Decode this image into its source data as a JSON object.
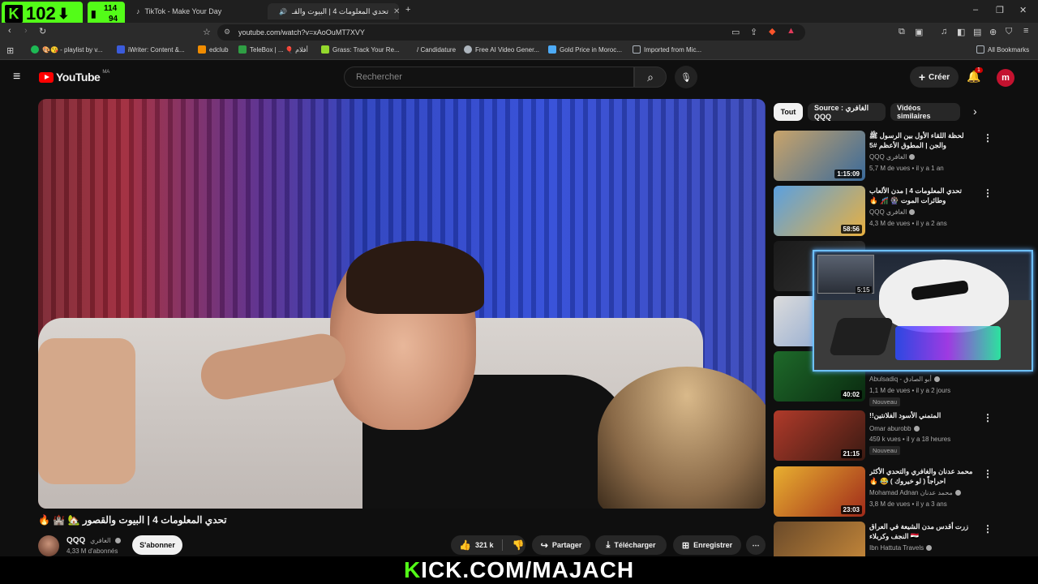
{
  "kick_overlay": {
    "viewer_count": "102",
    "stat_top": "114",
    "stat_bottom": "94",
    "banner_accent": "K",
    "banner_rest": "ICK.COM/MAJACH",
    "brand_color": "#53fc18"
  },
  "browser": {
    "tabs": [
      {
        "label": "TikTok - Make Your Day",
        "icon": "tiktok-icon"
      },
      {
        "label": "تحدي المعلومات 4 | البيوت والقـ",
        "icon": "youtube-icon",
        "active": true
      }
    ],
    "url": "youtube.com/watch?v=xAoOuMT7XVY",
    "bookmarks": [
      {
        "label": "🎨😘 - playlist by v...",
        "icon": "spotify-icon",
        "color": "#1db954"
      },
      {
        "label": "iWriter: Content &...",
        "icon": "iwriter-icon",
        "color": "#3b5bdb"
      },
      {
        "label": "edclub",
        "icon": "edclub-icon",
        "color": "#f08c00"
      },
      {
        "label": "TeleBox | ... 🎈 أفلام",
        "icon": "telebox-icon",
        "color": "#2f9e44"
      },
      {
        "label": "Grass: Track Your Re...",
        "icon": "grass-icon",
        "color": "#94d82d"
      },
      {
        "label": "/ Candidature",
        "icon": "candidature-icon",
        "color": "#868e96"
      },
      {
        "label": "Free AI Video Gener...",
        "icon": "ai-video-icon",
        "color": "#adb5bd"
      },
      {
        "label": "Gold Price in Moroc...",
        "icon": "gp-icon",
        "color": "#4dabf7"
      },
      {
        "label": "Imported from Mic...",
        "icon": "folder-icon",
        "color": "#adb5bd"
      }
    ],
    "all_bookmarks": "All Bookmarks"
  },
  "youtube": {
    "logo_text": "YouTube",
    "region": "MA",
    "search_placeholder": "Rechercher",
    "create_label": "Créer",
    "notification_count": "1",
    "video": {
      "title": "تحدي المعلومات 4 | البيوت والقصور 🏡 🏰 🔥",
      "channel": "QQQ",
      "channel_arabic": "الغافري",
      "subscribers": "4,33 M d'abonnés",
      "subscribe_label": "S'abonner",
      "likes": "321 k",
      "share_label": "Partager",
      "download_label": "Télécharger",
      "save_label": "Enregistrer"
    },
    "chips": [
      "Tout",
      "Source : الغافري QQQ",
      "Vidéos similaires"
    ],
    "recommendations": [
      {
        "title": "لحظة اللقاء الأول بين الرسول ﷺ والجن | المطوق الأعظم #5",
        "channel": "QQQ الغافري",
        "meta": "5,7 M de vues • il y a 1 an",
        "duration": "1:15:09",
        "thumb": [
          "#c9a46a",
          "#3a6a9a"
        ]
      },
      {
        "title": "تحدي المعلومات 4 | مدن الألعاب وطائرات الموت 🎡 🎢 🔥",
        "channel": "QQQ الغافري",
        "meta": "4,3 M de vues • il y a 2 ans",
        "duration": "58:56",
        "thumb": [
          "#5aa0e0",
          "#e8b040"
        ]
      },
      {
        "title": "",
        "channel": "",
        "meta": "",
        "duration": "",
        "thumb": [
          "#1a1a1a",
          "#333333"
        ]
      },
      {
        "title": "",
        "channel": "",
        "meta": "",
        "duration": "",
        "thumb": [
          "#dcdcdc",
          "#7a9acc"
        ]
      },
      {
        "title": "",
        "channel": "Abulsadiq - أبو الصادق",
        "meta": "1,1 M de vues • il y a 2 jours",
        "badge": "Nouveau",
        "duration": "40:02",
        "thumb": [
          "#1e6a2a",
          "#0a2a10"
        ]
      },
      {
        "title": "المتمني الأسود الفلانتين!!",
        "channel": "Omar aburobb",
        "meta": "459 k vues • il y a 18 heures",
        "badge": "Nouveau",
        "duration": "21:15",
        "thumb": [
          "#b03a2a",
          "#3a1a12"
        ]
      },
      {
        "title": "محمد عدنان والغافري والتحدي الأكثر احراجاً ( لو خيروك ) 😂 🔥",
        "channel": "Mohamad Adnan محمد عدنان",
        "meta": "3,8 M de vues • il y a 3 ans",
        "duration": "23:03",
        "thumb": [
          "#e8b030",
          "#a02a1a"
        ]
      },
      {
        "title": "زرت أقدس مدن الشيعة في العراق 🇮🇶 النجف وكربلاء",
        "channel": "Ibn Hattuta Travels",
        "meta": "",
        "duration": "",
        "thumb": [
          "#6a4a2a",
          "#c98a3a"
        ]
      }
    ],
    "overlay_cam_duration": "5:15"
  }
}
